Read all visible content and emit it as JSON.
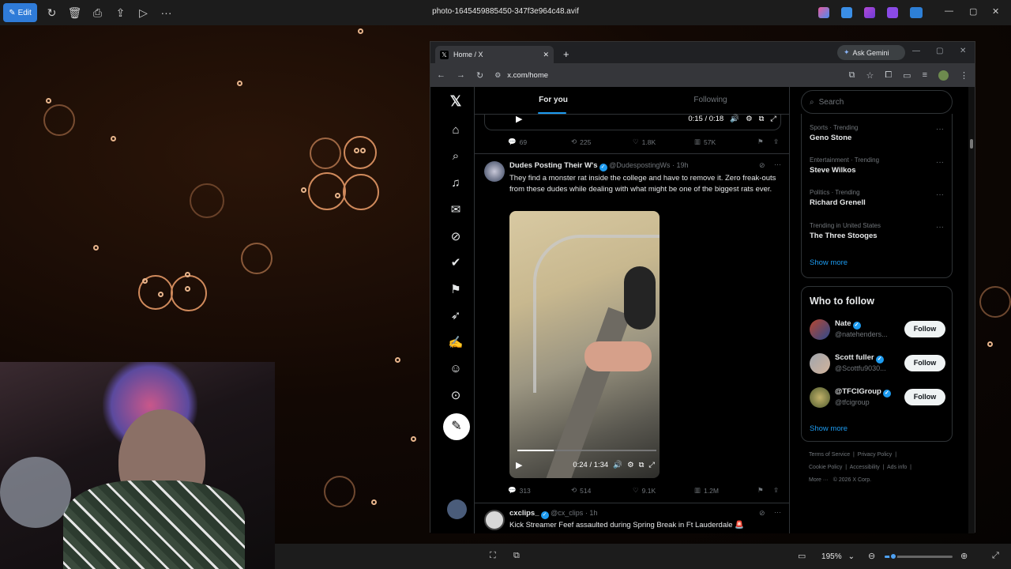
{
  "viewer": {
    "edit_label": "Edit",
    "file_name": "photo-1645459885450-347f3e964c48.avif",
    "zoom": "195%",
    "zoom_level": 0.13
  },
  "browser": {
    "tab_title": "Home / X",
    "ask_gemini": "Ask Gemini",
    "url": "x.com/home"
  },
  "x": {
    "tabs": [
      "For you",
      "Following"
    ],
    "video1": {
      "time": "0:15 / 0:18",
      "progress": 0.83
    },
    "post1_stats": {
      "replies": "69",
      "reposts": "225",
      "likes": "1.8K",
      "views": "57K"
    },
    "post2": {
      "name": "Dudes Posting Their W's",
      "handle": "@DudespostingWs",
      "time": "· 19h",
      "text": "They find a monster rat inside the college and have to remove it. Zero freak-outs from these dudes while dealing with what might be one of the biggest rats ever.",
      "video_time": "0:24 / 1:34",
      "progress": 0.26,
      "stats": {
        "replies": "313",
        "reposts": "514",
        "likes": "9.1K",
        "views": "1.2M"
      }
    },
    "post3": {
      "name": "cxclips_",
      "handle": "@cx_clips",
      "time": "· 1h",
      "text": "Kick Streamer Feef assaulted during Spring Break in Ft Lauderdale 🚨"
    },
    "search_placeholder": "Search",
    "trends": [
      {
        "category": "Sports · Trending",
        "name": "Geno Stone"
      },
      {
        "category": "Entertainment · Trending",
        "name": "Steve Wilkos"
      },
      {
        "category": "Politics · Trending",
        "name": "Richard Grenell"
      },
      {
        "category": "Trending in United States",
        "name": "The Three Stooges"
      }
    ],
    "show_more": "Show more",
    "who_to_follow_title": "Who to follow",
    "follow_suggestions": [
      {
        "name": "Nate",
        "handle": "@natehenders...",
        "button": "Follow"
      },
      {
        "name": "Scott fuller",
        "handle": "@Scottfu9030...",
        "button": "Follow"
      },
      {
        "name": "@TFCIGroup",
        "handle": "@tfcigroup",
        "button": "Follow"
      }
    ],
    "show_more_2": "Show more",
    "footer": {
      "terms": "Terms of Service",
      "privacy": "Privacy Policy",
      "cookie": "Cookie Policy",
      "accessibility": "Accessibility",
      "ads": "Ads info",
      "more": "More ···",
      "copyright": "© 2026 X Corp."
    }
  }
}
